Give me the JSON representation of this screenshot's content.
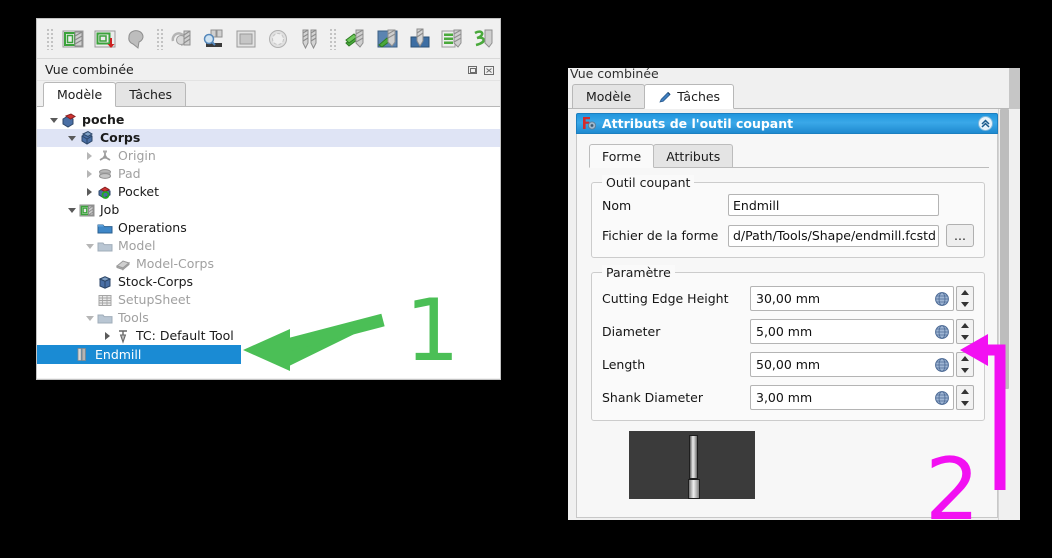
{
  "left_panel": {
    "toolbar": {
      "icons": [
        "path-job-icon",
        "path-job-export-icon",
        "path-inspect-icon",
        "path-profile-icon",
        "path-pocket-shape-icon",
        "path-face-icon",
        "path-helix-icon",
        "path-drilling-icon",
        "path-adaptive-icon",
        "path-surface-icon",
        "path-engrave-icon",
        "path-slot-icon",
        "path-waterline-icon"
      ]
    },
    "dock_title": "Vue combinée",
    "dock_buttons": [
      "float-icon",
      "close-icon"
    ],
    "tabs": [
      {
        "label": "Modèle",
        "active": true,
        "icon": null
      },
      {
        "label": "Tâches",
        "active": false,
        "icon": null
      }
    ],
    "tree": [
      {
        "label": "poche",
        "indent": 0,
        "arrow": "down",
        "icon": "document-icon",
        "bold": true,
        "dim": false,
        "select": "none"
      },
      {
        "label": "Corps",
        "indent": 1,
        "arrow": "down",
        "icon": "body-icon",
        "bold": true,
        "dim": false,
        "select": "soft"
      },
      {
        "label": "Origin",
        "indent": 2,
        "arrow": "right",
        "icon": "origin-icon",
        "bold": false,
        "dim": true,
        "select": "none"
      },
      {
        "label": "Pad",
        "indent": 2,
        "arrow": "right",
        "icon": "pad-icon",
        "bold": false,
        "dim": true,
        "select": "none"
      },
      {
        "label": "Pocket",
        "indent": 2,
        "arrow": "right",
        "icon": "pocket-icon",
        "bold": false,
        "dim": false,
        "select": "none"
      },
      {
        "label": "Job",
        "indent": 1,
        "arrow": "down",
        "icon": "job-icon",
        "bold": false,
        "dim": false,
        "select": "none"
      },
      {
        "label": "Operations",
        "indent": 2,
        "arrow": "none",
        "icon": "folder-icon",
        "bold": false,
        "dim": false,
        "select": "none"
      },
      {
        "label": "Model",
        "indent": 2,
        "arrow": "down",
        "icon": "folder-dim-icon",
        "bold": false,
        "dim": true,
        "select": "none"
      },
      {
        "label": "Model-Corps",
        "indent": 3,
        "arrow": "none",
        "icon": "model-corps-icon",
        "bold": false,
        "dim": true,
        "select": "none"
      },
      {
        "label": "Stock-Corps",
        "indent": 2,
        "arrow": "none",
        "icon": "stock-icon",
        "bold": false,
        "dim": false,
        "select": "none"
      },
      {
        "label": "SetupSheet",
        "indent": 2,
        "arrow": "none",
        "icon": "setupsheet-icon",
        "bold": false,
        "dim": true,
        "select": "none"
      },
      {
        "label": "Tools",
        "indent": 2,
        "arrow": "down",
        "icon": "folder-dim-icon",
        "bold": false,
        "dim": true,
        "select": "none"
      },
      {
        "label": "TC: Default Tool",
        "indent": 3,
        "arrow": "right",
        "icon": "toolcontroller-icon",
        "bold": false,
        "dim": false,
        "select": "none"
      },
      {
        "label": "Endmill",
        "indent": 4,
        "arrow": "none",
        "icon": "endmill-icon",
        "bold": false,
        "dim": false,
        "select": "strong"
      }
    ]
  },
  "right_panel": {
    "dock_title": "Vue combinée",
    "tabs": [
      {
        "label": "Modèle",
        "active": false,
        "icon": null
      },
      {
        "label": "Tâches",
        "active": true,
        "icon": "pencil-icon"
      }
    ],
    "task": {
      "header_title": "Attributs de l'outil coupant",
      "header_icon": "freecad-gear-icon",
      "collapse_icon": "chevron-double-up-icon",
      "header_color": "#2f9fe0",
      "inner_tabs": [
        {
          "label": "Forme",
          "active": true
        },
        {
          "label": "Attributs",
          "active": false
        }
      ],
      "group_tool": {
        "title": "Outil coupant",
        "fields": [
          {
            "label": "Nom",
            "value": "Endmill",
            "type": "text"
          },
          {
            "label": "Fichier de la forme",
            "value": "d/Path/Tools/Shape/endmill.fcstd",
            "type": "file",
            "button": "..."
          }
        ]
      },
      "group_param": {
        "title": "Paramètre",
        "fields": [
          {
            "label": "Cutting  Edge  Height",
            "value": "30,00 mm",
            "expr_icon": "expression-icon"
          },
          {
            "label": "Diameter",
            "value": "5,00 mm",
            "expr_icon": "expression-icon"
          },
          {
            "label": "Length",
            "value": "50,00 mm",
            "expr_icon": "expression-icon"
          },
          {
            "label": "Shank  Diameter",
            "value": "3,00 mm",
            "expr_icon": "expression-icon"
          }
        ]
      },
      "preview": {
        "name": "tool-3d-preview",
        "background": "#3b3b3b"
      }
    }
  },
  "annotations": [
    {
      "id": "1",
      "label": "1",
      "color": "#4bbf56",
      "kind": "arrow-left",
      "target": "tree-item-endmill"
    },
    {
      "id": "2",
      "label": "2",
      "color": "#f210f2",
      "kind": "elbow-arrow-left",
      "target": "diameter-spinner"
    }
  ]
}
